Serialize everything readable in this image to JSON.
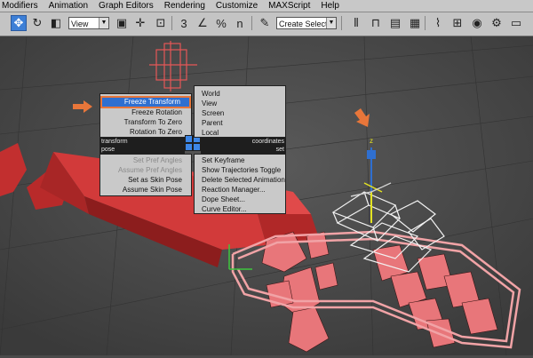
{
  "menu": [
    "Modifiers",
    "Animation",
    "Graph Editors",
    "Rendering",
    "Customize",
    "MAXScript",
    "Help"
  ],
  "toolbar": {
    "ref_coord": "View",
    "selection_set_placeholder": "Create Selection Se",
    "snap_label": "3",
    "percent_snap_label": "%",
    "spinner_snap_label": "n"
  },
  "quad": {
    "left_top": [
      "Freeze Transform",
      "Freeze Rotation",
      "Transform To Zero",
      "Rotation To Zero"
    ],
    "header_transform": "transform",
    "header_coordinates": "coordinates",
    "header_pose": "pose",
    "header_set": "set",
    "left_bottom": [
      {
        "label": "Set Pref Angles",
        "disabled": true
      },
      {
        "label": "Assume Pref Angles",
        "disabled": true
      },
      {
        "label": "Set as Skin Pose",
        "disabled": false
      },
      {
        "label": "Assume Skin Pose",
        "disabled": false
      }
    ],
    "right_top": [
      "World",
      "View",
      "Screen",
      "Parent",
      "Local"
    ],
    "right_bottom": [
      "Set Keyframe",
      "Show Trajectories Toggle",
      "Delete Selected Animation",
      "Reaction Manager...",
      "Dope Sheet...",
      "Curve Editor..."
    ]
  },
  "viewport": {
    "axis_label": "z"
  },
  "colors": {
    "menu_highlight": "#2f6fd0",
    "callout_orange": "#e8763a",
    "object_red": "#d93b3b"
  }
}
